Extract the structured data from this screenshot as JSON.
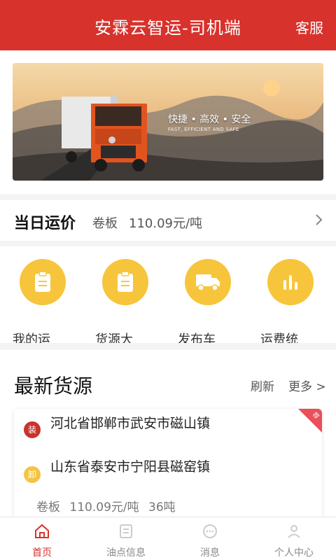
{
  "header": {
    "title": "安霖云智运-司机端",
    "service_label": "客服"
  },
  "banner": {
    "slogan_cn": "快捷 • 高效 • 安全",
    "slogan_en": "FAST, EFFICIENT AND SAFE"
  },
  "daily_price": {
    "label": "当日运价",
    "category": "卷板",
    "value": "110.09元/吨"
  },
  "menu": {
    "items": [
      {
        "label": "我的运",
        "icon": "clipboard-icon"
      },
      {
        "label": "货源大",
        "icon": "clipboard-icon"
      },
      {
        "label": "发布车",
        "icon": "truck-icon"
      },
      {
        "label": "运费统",
        "icon": "bar-chart-icon"
      }
    ]
  },
  "latest": {
    "title": "最新货源",
    "refresh_label": "刷新",
    "more_label": "更多 >",
    "card": {
      "corner_badge": "荐",
      "load_badge": "装",
      "unload_badge": "卸",
      "load_address": "河北省邯郸市武安市磁山镇",
      "unload_address": "山东省泰安市宁阳县磁窑镇",
      "cargo": "卷板",
      "price": "110.09元/吨",
      "weight": "36吨"
    }
  },
  "tabbar": {
    "tabs": [
      {
        "label": "首页",
        "icon": "home-icon",
        "active": true
      },
      {
        "label": "油点信息",
        "icon": "list-icon",
        "active": false
      },
      {
        "label": "消息",
        "icon": "message-icon",
        "active": false
      },
      {
        "label": "个人中心",
        "icon": "person-icon",
        "active": false
      }
    ]
  },
  "colors": {
    "brand_red": "#d8322c",
    "accent_yellow": "#f7c53b"
  }
}
